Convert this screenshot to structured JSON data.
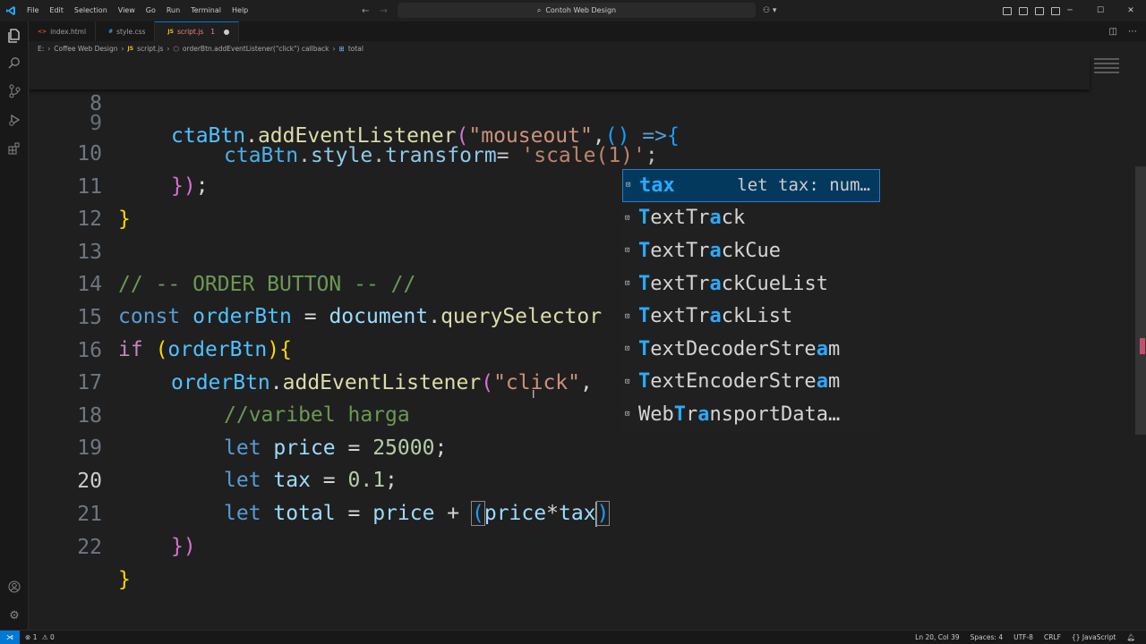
{
  "menu": [
    "File",
    "Edit",
    "Selection",
    "View",
    "Go",
    "Run",
    "Terminal",
    "Help"
  ],
  "command_center": "Contoh Web Design",
  "tabs": [
    {
      "label": "index.html",
      "icon": "<>",
      "color": "#e44d26",
      "active": false
    },
    {
      "label": "style.css",
      "icon": "#",
      "color": "#42a5f5",
      "active": false
    },
    {
      "label": "script.js",
      "icon": "JS",
      "color": "#f1bf26",
      "active": true,
      "badge": "1"
    }
  ],
  "breadcrumb": [
    "E:",
    "Coffee Web Design",
    "script.js",
    "orderBtn.addEventListener(\"click\") callback",
    "total"
  ],
  "editor": {
    "sticky": {
      "line": "8",
      "peek_line": "9"
    },
    "lines": [
      "10",
      "11",
      "12",
      "13",
      "14",
      "15",
      "16",
      "17",
      "18",
      "19",
      "20",
      "21",
      "22"
    ],
    "current_line": "20"
  },
  "suggest": {
    "selected": {
      "label": "tax",
      "detail": "let tax: num…"
    },
    "items": [
      "TextTrack",
      "TextTrackCue",
      "TextTrackCueList",
      "TextTrackList",
      "TextDecoderStream",
      "TextEncoderStream",
      "WebTransportData…"
    ]
  },
  "status": {
    "errors": "1",
    "warnings": "0",
    "position": "Ln 20, Col 39",
    "spaces": "Spaces: 4",
    "encoding": "UTF-8",
    "eol": "CRLF",
    "language": "JavaScript"
  },
  "colors": {
    "accent": "#0078d4",
    "selection": "#04395e",
    "match": "#2aaaff"
  }
}
